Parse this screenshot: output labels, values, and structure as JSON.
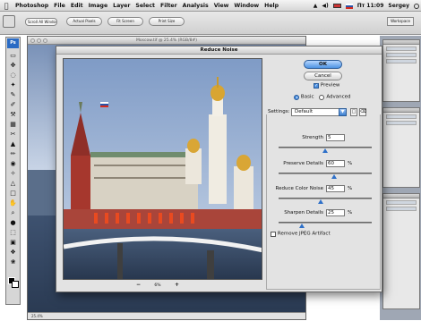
{
  "menubar": {
    "app_name": "Photoshop",
    "items": [
      "File",
      "Edit",
      "Image",
      "Layer",
      "Select",
      "Filter",
      "Analysis",
      "View",
      "Window",
      "Help"
    ],
    "clock": "Пт 11:09",
    "user": "Sergey"
  },
  "options_bar": {
    "scroll_all_windows": "Scroll All Windows",
    "actual_pixels": "Actual Pixels",
    "fit_screen": "Fit Screen",
    "print_size": "Print Size",
    "workspace": "Workspace"
  },
  "document": {
    "title": "Moscow.tif @ 25.4% (RGB/8#)",
    "status": "25.4%"
  },
  "dialog": {
    "title": "Reduce Noise",
    "ok_label": "OK",
    "cancel_label": "Cancel",
    "preview_label": "Preview",
    "preview_checked": true,
    "mode_basic_label": "Basic",
    "mode_advanced_label": "Advanced",
    "mode_selected": "Basic",
    "settings_label": "Settings:",
    "settings_value": "Default",
    "zoom_level": "6%",
    "zoom_minus": "−",
    "zoom_plus": "+",
    "controls": [
      {
        "label": "Strength",
        "value": "5",
        "unit": "",
        "fraction": 0.5
      },
      {
        "label": "Preserve Details",
        "value": "60",
        "unit": "%",
        "fraction": 0.6
      },
      {
        "label": "Reduce Color Noise",
        "value": "45",
        "unit": "%",
        "fraction": 0.45
      },
      {
        "label": "Sharpen Details",
        "value": "25",
        "unit": "%",
        "fraction": 0.25
      }
    ],
    "remove_jpeg_label": "Remove JPEG Artifact",
    "remove_jpeg_checked": false
  },
  "colors": {
    "accent": "#4a8ee0",
    "dialog_bg": "#e3e3e3",
    "flag": [
      "#ffffff",
      "#2b54a8",
      "#d52b1e"
    ]
  }
}
